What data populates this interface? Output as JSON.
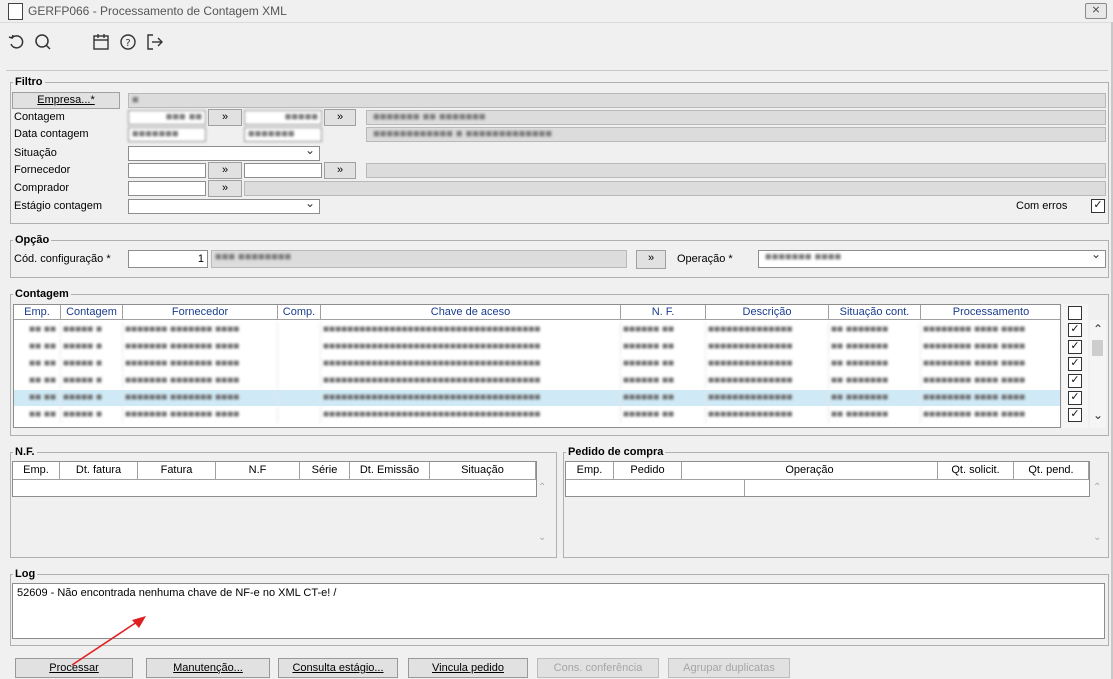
{
  "window": {
    "title": "GERFP066 - Processamento de Contagem XML",
    "close": "⨯"
  },
  "toolbar": {
    "undo": "↺",
    "search": "⚲",
    "calendar": "📅",
    "help": "?",
    "exit": "↦"
  },
  "filtro": {
    "label": "Filtro",
    "empresa_btn": "Empresa...*",
    "contagem_label": "Contagem",
    "data_contagem_label": "Data contagem",
    "situacao_label": "Situação",
    "fornecedor_label": "Fornecedor",
    "comprador_label": "Comprador",
    "estagio_label": "Estágio contagem",
    "com_erros_label": "Com erros",
    "arrow": "»"
  },
  "opcao": {
    "label": "Opção",
    "cod_config_label": "Cód. configuração *",
    "cod_config_value": "1",
    "operacao_label": "Operação *",
    "arrow": "»"
  },
  "contagem": {
    "label": "Contagem",
    "columns": [
      "Emp.",
      "Contagem",
      "Fornecedor",
      "Comp.",
      "Chave de aceso",
      "N. F.",
      "Descrição",
      "Situação cont.",
      "Processamento"
    ]
  },
  "nf": {
    "label": "N.F.",
    "columns": [
      "Emp.",
      "Dt. fatura",
      "Fatura",
      "N.F",
      "Série",
      "Dt. Emissão",
      "Situação"
    ]
  },
  "pedido": {
    "label": "Pedido de compra",
    "columns": [
      "Emp.",
      "Pedido",
      "Operação",
      "Qt. solicit.",
      "Qt. pend."
    ]
  },
  "log": {
    "label": "Log",
    "text": "52609 - Não encontrada nenhuma chave de NF-e no XML CT-e! /"
  },
  "buttons": {
    "processar": "Processar",
    "manutencao": "Manutenção...",
    "consulta_estagio": "Consulta estágio...",
    "vincula_pedido": "Vincula pedido",
    "cons_conferencia": "Cons. conferência",
    "agrupar_duplicatas": "Agrupar duplicatas"
  },
  "colors": {
    "selected_row": "#cfeaf6",
    "annotation_arrow": "#e02020"
  }
}
